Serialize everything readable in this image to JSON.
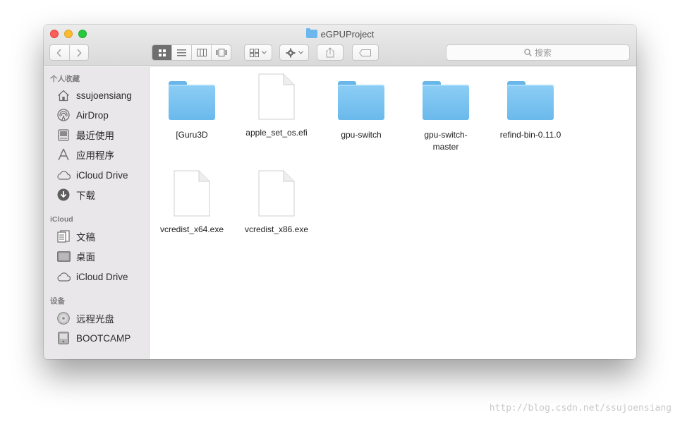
{
  "window": {
    "title": "eGPUProject"
  },
  "toolbar": {
    "search_placeholder": "搜索"
  },
  "sidebar": {
    "sections": [
      {
        "title": "个人收藏",
        "items": [
          {
            "label": "ssujoensiang",
            "icon": "home-icon"
          },
          {
            "label": "AirDrop",
            "icon": "airdrop-icon"
          },
          {
            "label": "最近使用",
            "icon": "recents-icon"
          },
          {
            "label": "应用程序",
            "icon": "applications-icon"
          },
          {
            "label": "iCloud Drive",
            "icon": "cloud-icon"
          },
          {
            "label": "下载",
            "icon": "download-icon"
          }
        ]
      },
      {
        "title": "iCloud",
        "items": [
          {
            "label": "文稿",
            "icon": "documents-icon"
          },
          {
            "label": "桌面",
            "icon": "desktop-icon"
          },
          {
            "label": "iCloud Drive",
            "icon": "cloud-icon"
          }
        ]
      },
      {
        "title": "设备",
        "items": [
          {
            "label": "远程光盘",
            "icon": "remote-disc-icon"
          },
          {
            "label": "BOOTCAMP",
            "icon": "disk-icon"
          }
        ]
      }
    ]
  },
  "files": [
    {
      "name": "[Guru3D",
      "type": "folder"
    },
    {
      "name": "apple_set_os.efi",
      "type": "document"
    },
    {
      "name": "gpu-switch",
      "type": "folder"
    },
    {
      "name": "gpu-switch-master",
      "type": "folder"
    },
    {
      "name": "refind-bin-0.11.0",
      "type": "folder"
    },
    {
      "name": "vcredist_x64.exe",
      "type": "document"
    },
    {
      "name": "vcredist_x86.exe",
      "type": "document"
    }
  ],
  "watermark": "http://blog.csdn.net/ssujoensiang",
  "colors": {
    "folder_blue": "#6ab9ec",
    "sidebar_bg": "#e9e7ea",
    "close": "#fc5f57",
    "minimize": "#fdbc2e",
    "maximize": "#28c840"
  }
}
